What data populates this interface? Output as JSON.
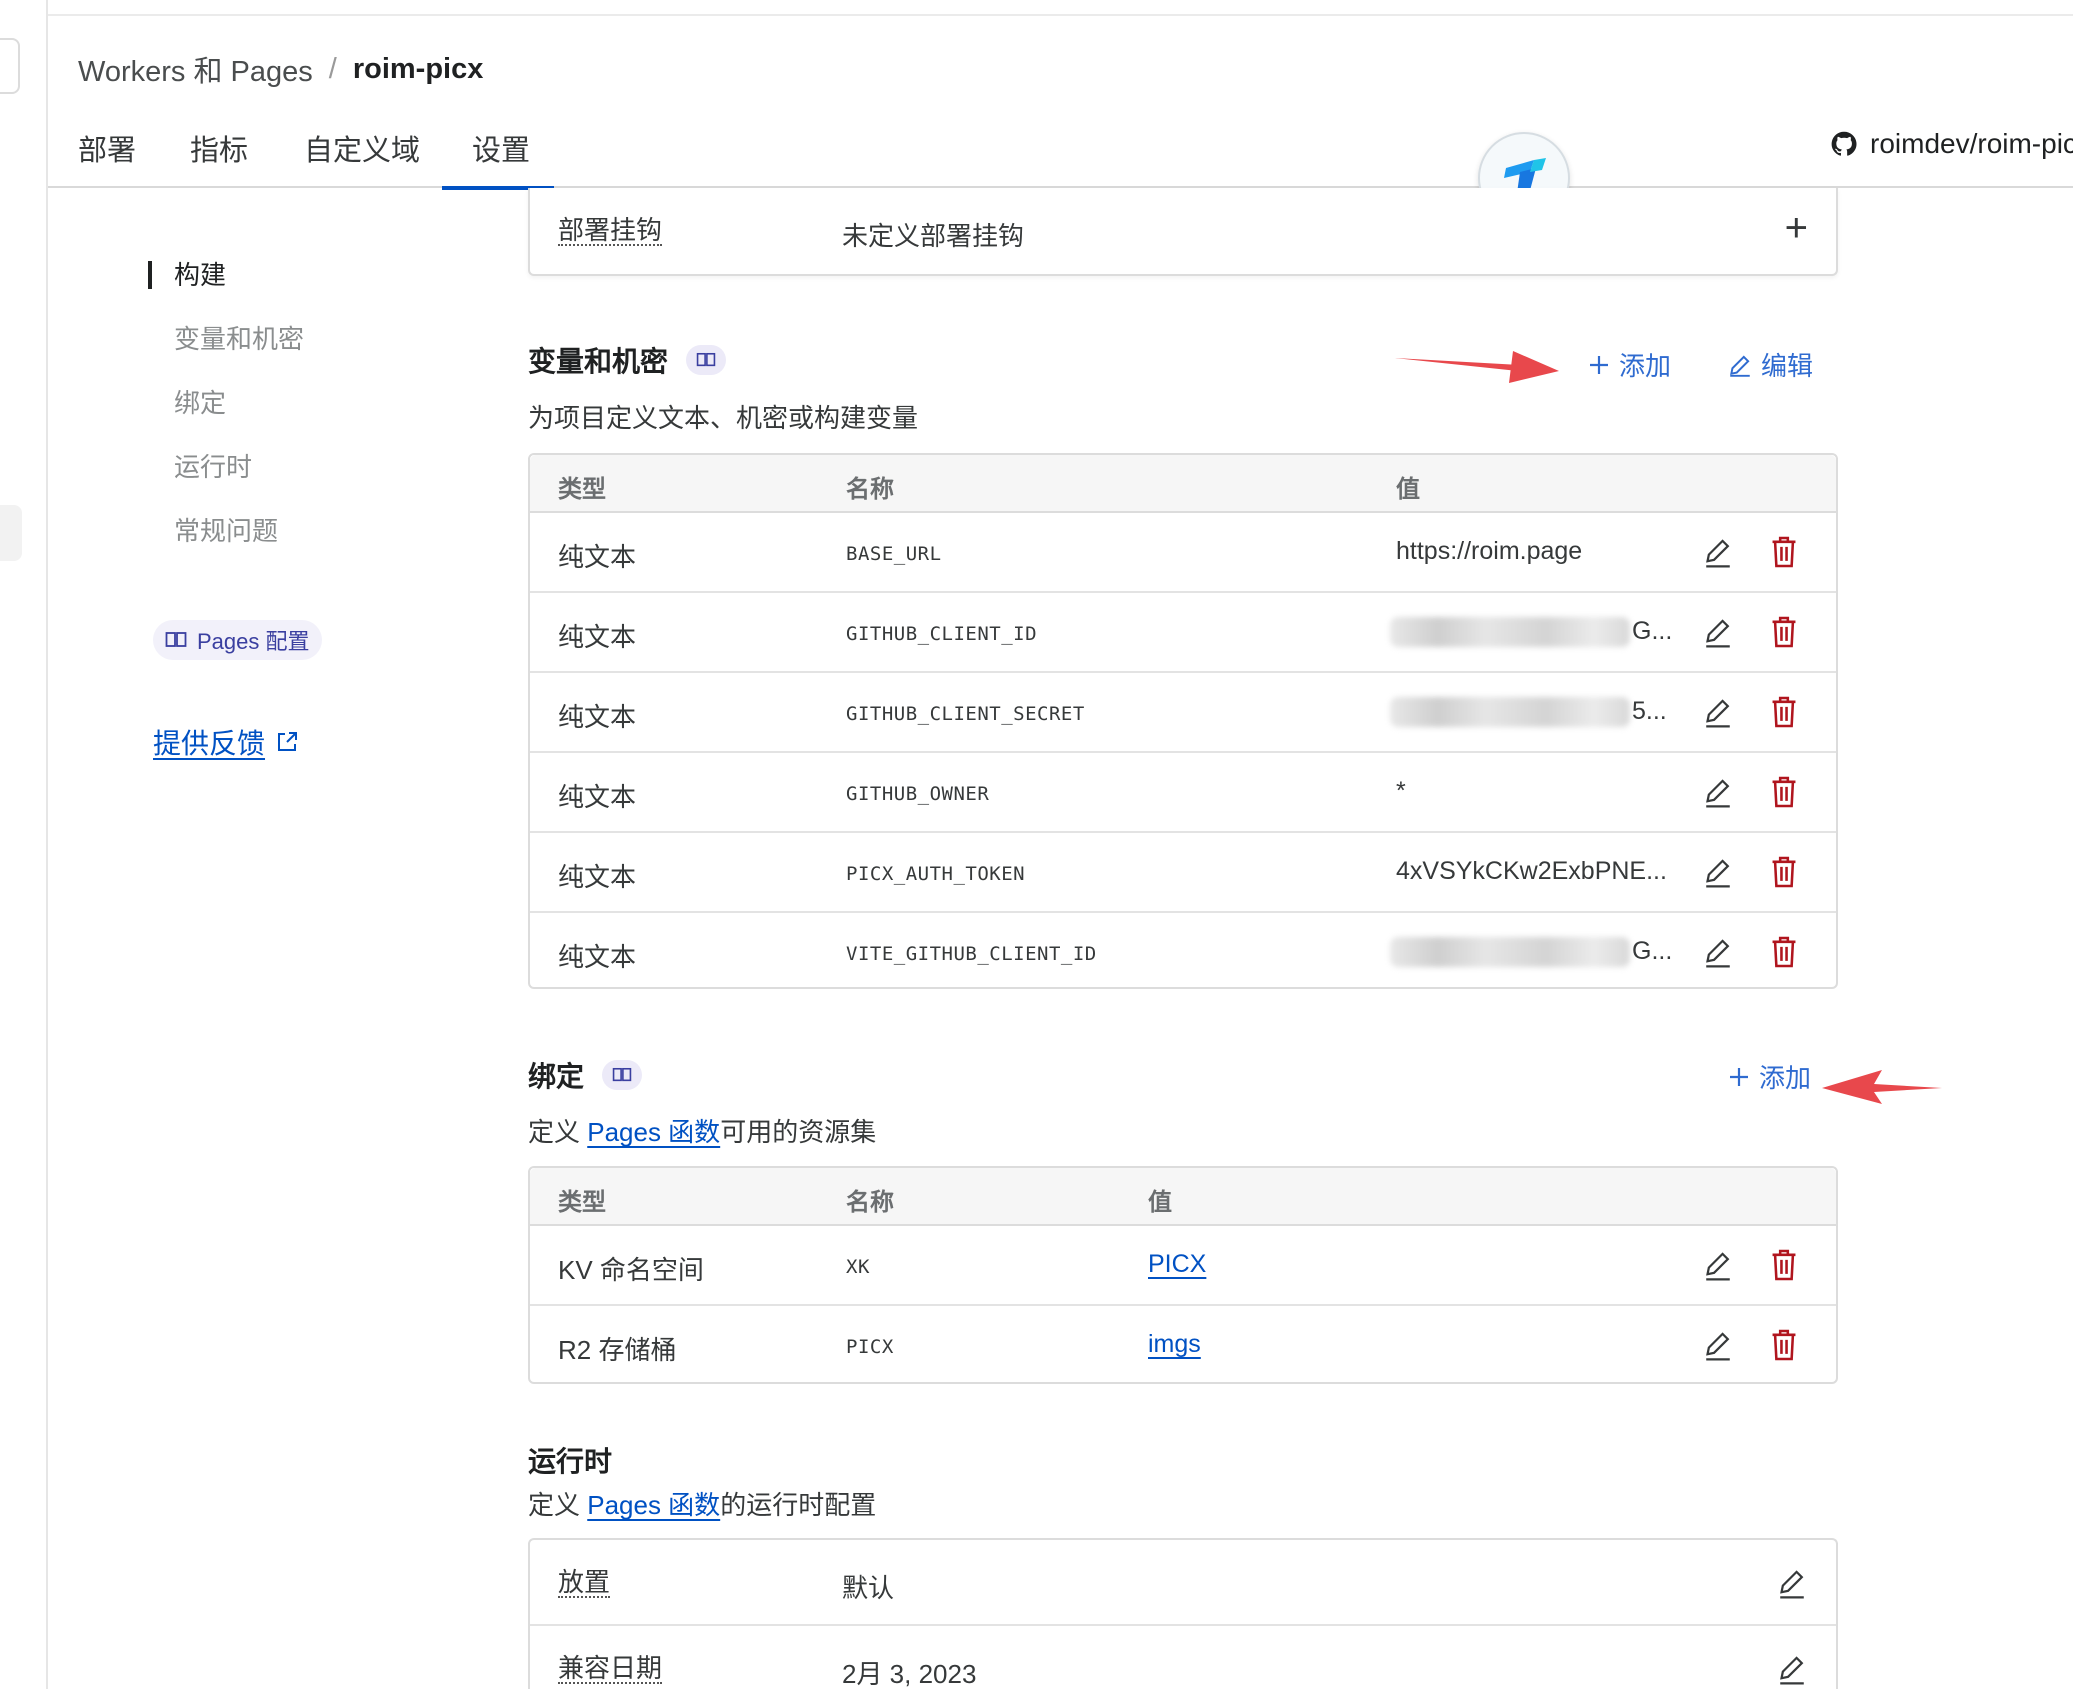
{
  "breadcrumb": {
    "parent": "Workers 和 Pages",
    "separator": "/",
    "current": "roim-picx"
  },
  "tabs": [
    {
      "label": "部署"
    },
    {
      "label": "指标"
    },
    {
      "label": "自定义域"
    },
    {
      "label": "设置",
      "active": true
    }
  ],
  "repo": {
    "label": "roimdev/roim-pic",
    "icon": "github-icon"
  },
  "sidebar": {
    "items": [
      {
        "label": "构建",
        "active": true
      },
      {
        "label": "变量和机密"
      },
      {
        "label": "绑定"
      },
      {
        "label": "运行时"
      },
      {
        "label": "常规问题"
      }
    ],
    "pages_config": "Pages 配置",
    "feedback": "提供反馈"
  },
  "deploy_hook": {
    "label": "部署挂钩",
    "value": "未定义部署挂钩",
    "add_symbol": "+"
  },
  "variables": {
    "title": "变量和机密",
    "description": "为项目定义文本、机密或构建变量",
    "add_label": "添加",
    "edit_label": "编辑",
    "headers": {
      "type": "类型",
      "name": "名称",
      "value": "值"
    },
    "rows": [
      {
        "type": "纯文本",
        "name": "BASE_URL",
        "value": "https://roim.page"
      },
      {
        "type": "纯文本",
        "name": "GITHUB_CLIENT_ID",
        "value": "IV23...G...",
        "redacted": true,
        "visible_suffix": "G..."
      },
      {
        "type": "纯文本",
        "name": "GITHUB_CLIENT_SECRET",
        "value": "...5...",
        "redacted": true,
        "visible_suffix": "5..."
      },
      {
        "type": "纯文本",
        "name": "GITHUB_OWNER",
        "value": "*"
      },
      {
        "type": "纯文本",
        "name": "PICX_AUTH_TOKEN",
        "value": "4xVSYkCKw2ExbPNE..."
      },
      {
        "type": "纯文本",
        "name": "VITE_GITHUB_CLIENT_ID",
        "value": "...G...",
        "redacted": true,
        "visible_suffix": "G..."
      }
    ]
  },
  "bindings": {
    "title": "绑定",
    "description_prefix": "定义 ",
    "description_link": "Pages 函数",
    "description_suffix": "可用的资源集",
    "add_label": "添加",
    "headers": {
      "type": "类型",
      "name": "名称",
      "value": "值"
    },
    "rows": [
      {
        "type": "KV 命名空间",
        "name": "XK",
        "value": "PICX"
      },
      {
        "type": "R2 存储桶",
        "name": "PICX",
        "value": "imgs"
      }
    ]
  },
  "runtime": {
    "title": "运行时",
    "description_prefix": "定义 ",
    "description_link": "Pages 函数",
    "description_suffix": "的运行时配置",
    "rows": [
      {
        "label": "放置",
        "value": "默认"
      },
      {
        "label": "兼容日期",
        "value": "2月 3, 2023"
      }
    ]
  },
  "colors": {
    "accent": "#0051c3",
    "danger": "#b0151e",
    "arrow": "#e8484c"
  }
}
